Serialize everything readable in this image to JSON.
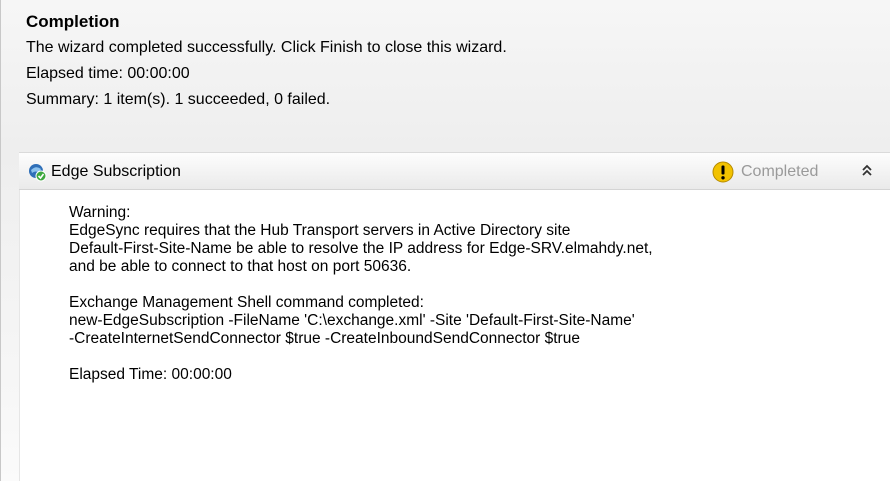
{
  "header": {
    "title": "Completion",
    "message": "The wizard completed successfully. Click Finish to close this wizard.",
    "elapsed": "Elapsed time: 00:00:00",
    "summary": "Summary: 1 item(s). 1 succeeded, 0 failed."
  },
  "task": {
    "icon": "edge-subscription-icon",
    "title": "Edge Subscription",
    "status_icon": "warning-icon",
    "status": "Completed",
    "collapse_icon": "double-chevron-up-icon",
    "warning_lines": [
      "Warning:",
      "EdgeSync requires that the Hub Transport servers in Active Directory site",
      "Default-First-Site-Name be able to resolve the IP address for Edge-SRV.elmahdy.net,",
      "and be able to connect to that host on port 50636."
    ],
    "command_lines": [
      "Exchange Management Shell command completed:",
      "new-EdgeSubscription -FileName 'C:\\exchange.xml' -Site 'Default-First-Site-Name'",
      "-CreateInternetSendConnector $true -CreateInboundSendConnector $true"
    ],
    "elapsed": "Elapsed Time: 00:00:00"
  },
  "colors": {
    "status_text": "#9a9a9a",
    "warning_yellow": "#f2c200",
    "icon_blue": "#2f6fb8",
    "icon_green": "#3ea83e"
  }
}
